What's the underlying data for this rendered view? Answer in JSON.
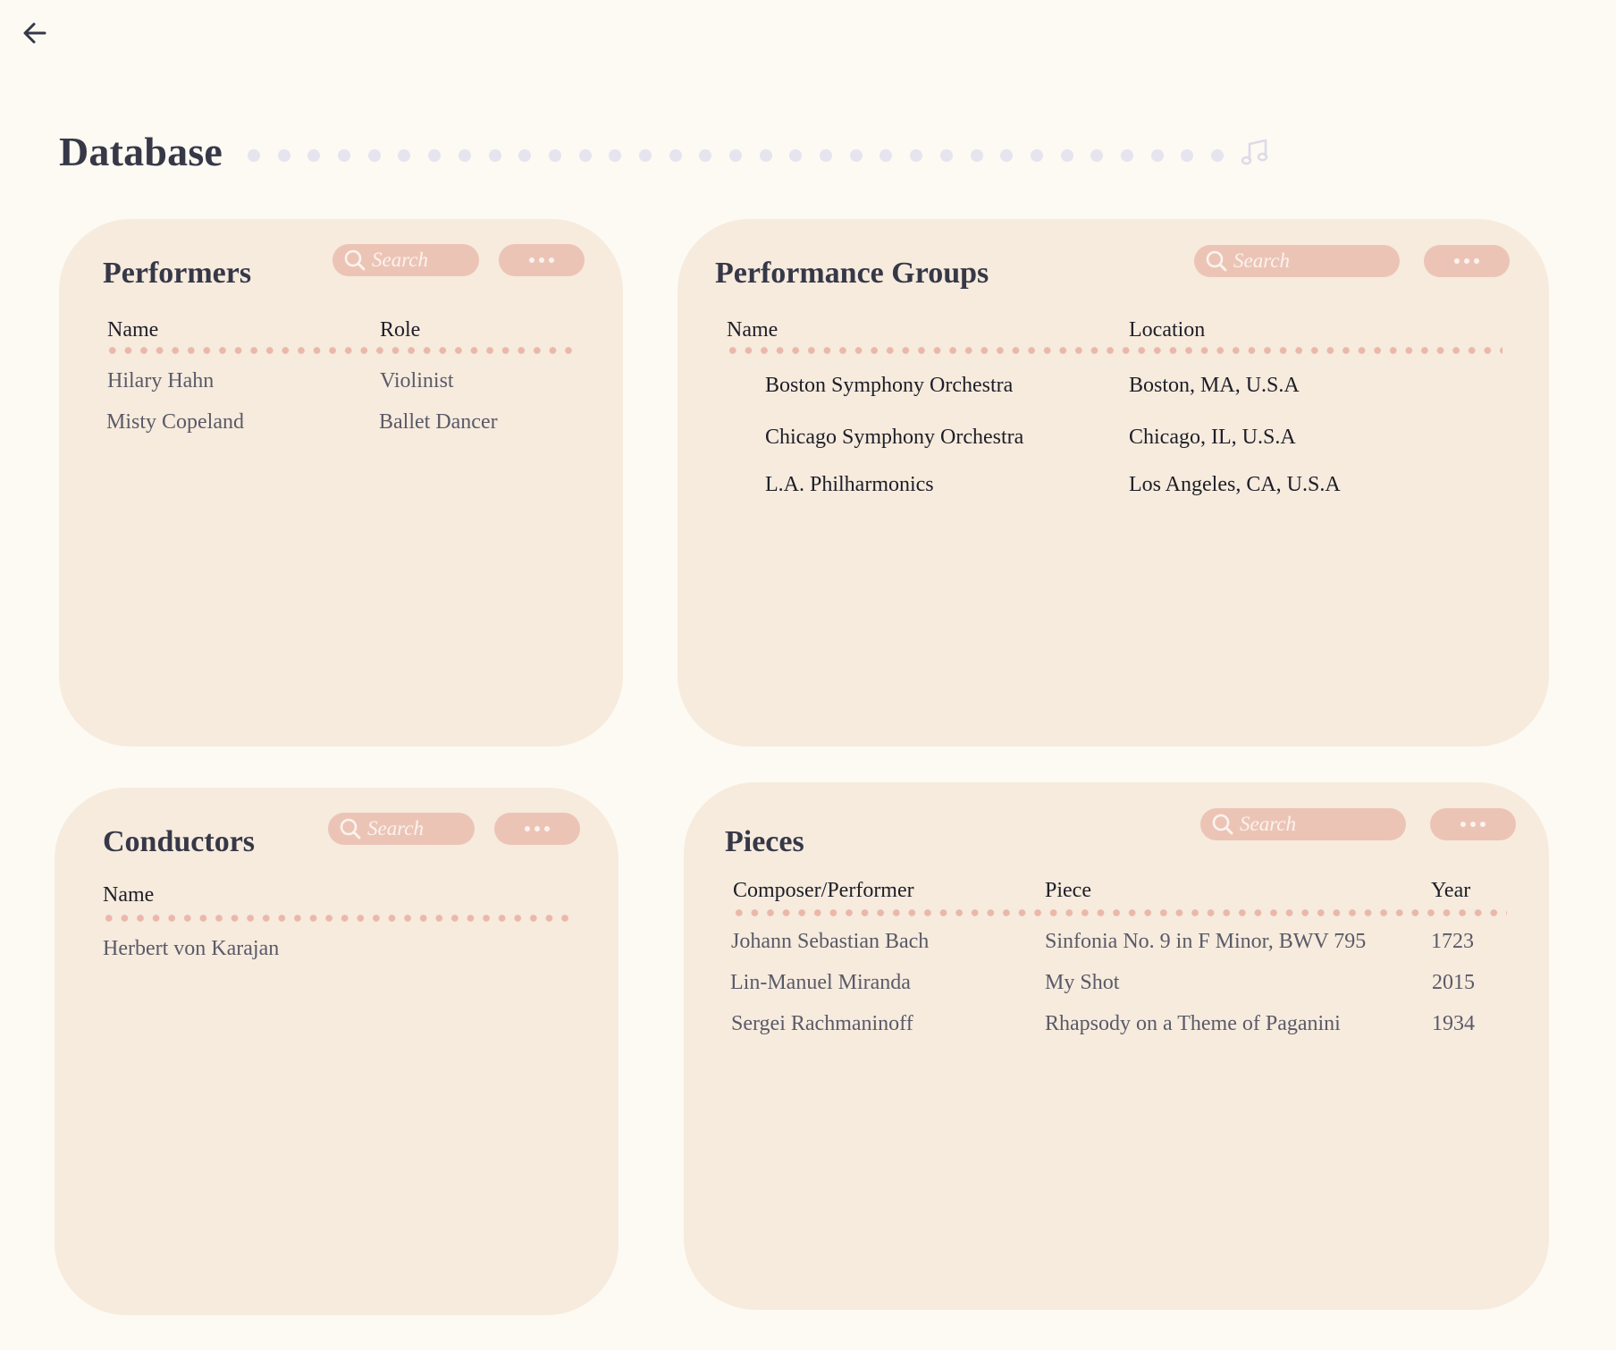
{
  "app": {
    "back_label": "Back"
  },
  "header": {
    "title": "Database",
    "decoration_icon": "music-note-icon"
  },
  "colors": {
    "background": "#fdfaf3",
    "card": "#f6ebdd",
    "pill": "#ecc4b6",
    "divider_dots": "#eab8aa",
    "title_dots": "#e6e4ee",
    "heading": "#363848"
  },
  "performers": {
    "title": "Performers",
    "search_placeholder": "Search",
    "columns": [
      "Name",
      "Role"
    ],
    "rows": [
      {
        "name": "Hilary Hahn",
        "role": "Violinist"
      },
      {
        "name": "Misty Copeland",
        "role": "Ballet Dancer"
      }
    ]
  },
  "groups": {
    "title": "Performance Groups",
    "search_placeholder": "Search",
    "columns": [
      "Name",
      "Location"
    ],
    "rows": [
      {
        "name": "Boston Symphony Orchestra",
        "location": "Boston, MA, U.S.A"
      },
      {
        "name": "Chicago Symphony Orchestra",
        "location": "Chicago, IL, U.S.A"
      },
      {
        "name": "L.A. Philharmonics",
        "location": "Los Angeles, CA, U.S.A"
      }
    ]
  },
  "conductors": {
    "title": "Conductors",
    "search_placeholder": "Search",
    "columns": [
      "Name"
    ],
    "rows": [
      {
        "name": "Herbert von Karajan"
      }
    ]
  },
  "pieces": {
    "title": "Pieces",
    "search_placeholder": "Search",
    "columns": [
      "Composer/Performer",
      "Piece",
      "Year"
    ],
    "rows": [
      {
        "composer": "Johann Sebastian Bach",
        "piece": "Sinfonia No. 9 in F Minor, BWV 795",
        "year": "1723"
      },
      {
        "composer": "Lin-Manuel Miranda",
        "piece": "My Shot",
        "year": "2015"
      },
      {
        "composer": "Sergei Rachmaninoff",
        "piece": "Rhapsody on a Theme of Paganini",
        "year": "1934"
      }
    ]
  }
}
